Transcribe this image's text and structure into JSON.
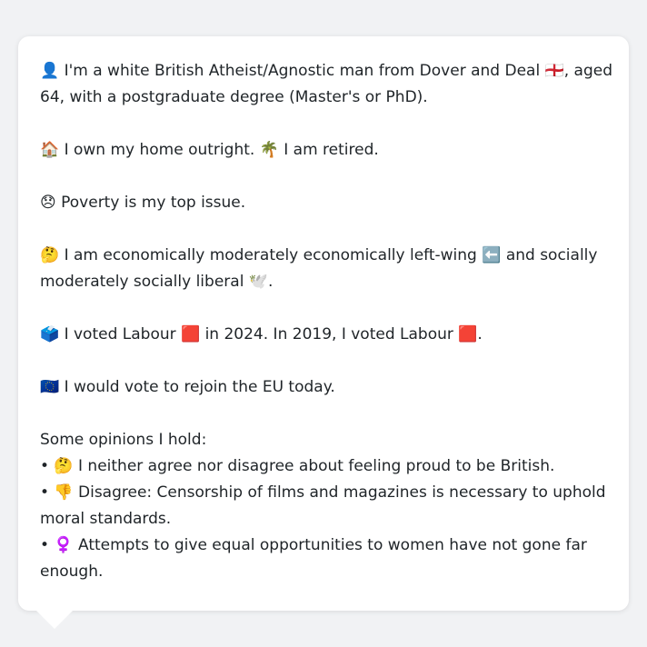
{
  "profile": {
    "intro_line1": "👤 I'm a white British Atheist/Agnostic man from Dover and Deal 🏴󠁧󠁢󠁥󠁮󠁧󠁿, aged",
    "intro_line2": "64, with a postgraduate degree (Master's or PhD).",
    "home": "🏠 I own my home outright. 🌴 I am retired.",
    "issue": "😞 Poverty is my top issue.",
    "politics_line1": "🤔 I am economically moderately economically left-wing ⬅️ and socially",
    "politics_line2": "moderately socially liberal 🕊️.",
    "votes": "🗳️ I voted Labour 🟥 in 2024. In 2019, I voted Labour 🟥.",
    "eu": "🇪🇺 I would vote to rejoin the EU today."
  },
  "opinions": {
    "heading": "Some opinions I hold:",
    "item1": "• 🤔 I neither agree nor disagree about feeling proud to be British.",
    "item2_line1": "• 👎 Disagree: Censorship of films and magazines is necessary to uphold",
    "item2_line2": "moral standards.",
    "item3_line1": "• ♀️ Attempts to give equal opportunities to women have not gone far",
    "item3_line2": "enough."
  }
}
